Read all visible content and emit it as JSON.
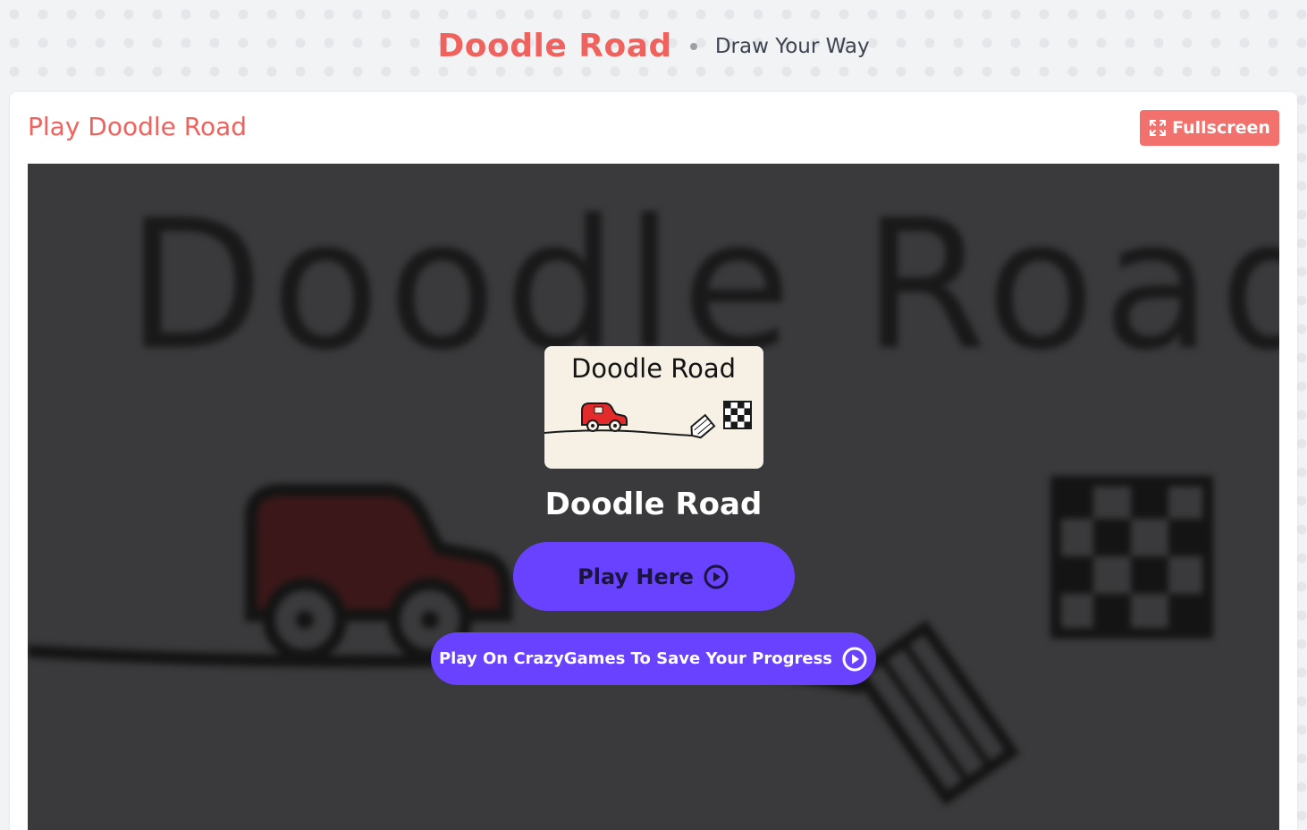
{
  "header": {
    "title": "Doodle Road",
    "tagline": "Draw Your Way"
  },
  "card": {
    "title": "Play Doodle Road",
    "fullscreen_label": "Fullscreen"
  },
  "game": {
    "background_title": "Doodle Road",
    "thumbnail_title": "Doodle Road",
    "name": "Doodle Road",
    "play_here_label": "Play Here",
    "play_crazygames_label": "Play On CrazyGames To Save Your Progress"
  },
  "icons": {
    "fullscreen": "expand-icon",
    "play": "play-circle-icon",
    "car": "car-icon",
    "flag": "checkered-flag-icon",
    "pencil": "pencil-icon"
  },
  "colors": {
    "accent": "#f0625d",
    "button_primary": "#6842ff",
    "fullscreen_button": "#f2716c",
    "game_overlay": "#3a3a3c"
  }
}
